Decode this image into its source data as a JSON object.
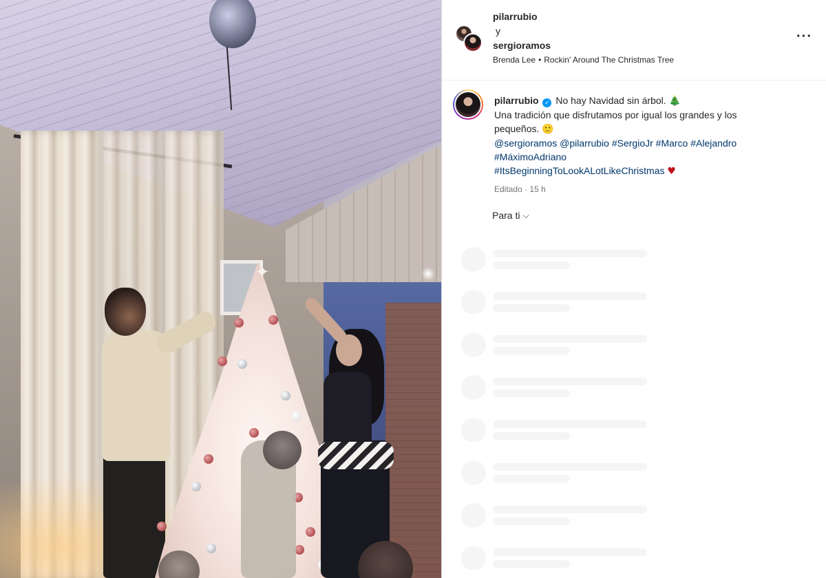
{
  "post": {
    "header": {
      "user1": "pilarrubio",
      "connector": "y",
      "user2": "sergioramos",
      "audio_artist": "Brenda Lee",
      "audio_separator": "•",
      "audio_track": "Rockin' Around The Christmas Tree",
      "more_glyph": "···"
    },
    "caption": {
      "username": "pilarrubio",
      "verified_glyph": "✓",
      "line1": "No hay Navidad sin árbol.",
      "emoji_tree": "🎄",
      "line2": "Una tradición que disfrutamos por igual los grandes y los pequeños.",
      "emoji_smile": "🙂",
      "mentions": [
        "@sergioramos",
        "@pilarrubio",
        "#SergioJr",
        "#Marco",
        "#Alejandro",
        "#MáximoAdriano"
      ],
      "hashtag_last": "#ItsBeginningToLookALotLikeChristmas",
      "emoji_heart": "♥",
      "meta_edited": "Editado",
      "meta_separator": "·",
      "meta_time": "15 h"
    },
    "comments_filter": {
      "label": "Para ti",
      "chevron": "⌵"
    },
    "comment_placeholders": 8
  },
  "colors": {
    "link": "#00376b",
    "verified": "#0095f6",
    "meta_text": "#737373",
    "skeleton": "#f5f5f5",
    "divider": "#dbdbdb"
  },
  "icons": {
    "more": "more-options-icon",
    "verified": "verified-badge-icon",
    "chevron": "chevron-down-icon"
  }
}
